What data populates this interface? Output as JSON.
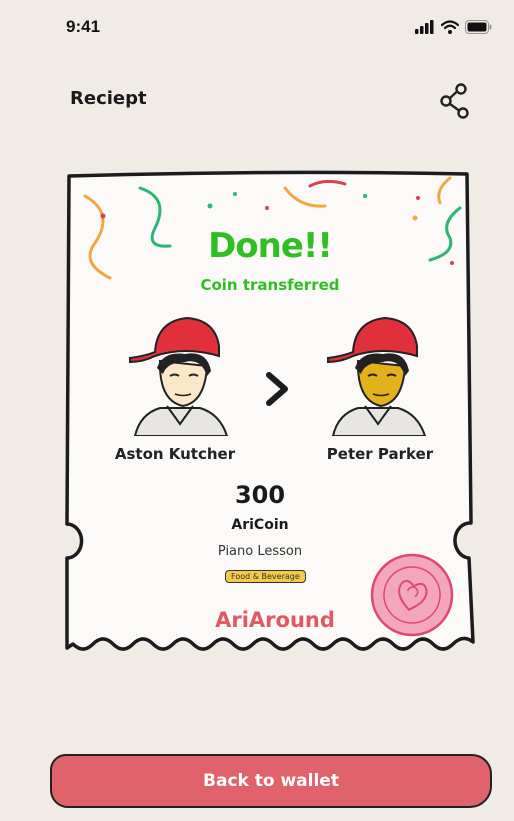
{
  "status_bar": {
    "time": "9:41",
    "icons": [
      "signal-icon",
      "wifi-icon",
      "battery-icon"
    ]
  },
  "header": {
    "title": "Reciept",
    "share_icon": "share-icon"
  },
  "receipt": {
    "headline": "Done!!",
    "subheadline": "Coin transferred",
    "sender": {
      "name": "Aston Kutcher"
    },
    "recipient": {
      "name": "Peter Parker"
    },
    "amount": "300",
    "currency": "AriCoin",
    "description": "Piano Lesson",
    "category": "Food & Beverage",
    "brand": "AriAround",
    "stamp_label": "AriAround"
  },
  "footer": {
    "back_button_label": "Back to wallet"
  },
  "colors": {
    "background": "#f1ebe6",
    "success": "#2fbf22",
    "brand": "#e05a63",
    "button": "#e0636b",
    "badge": "#f7c948"
  }
}
